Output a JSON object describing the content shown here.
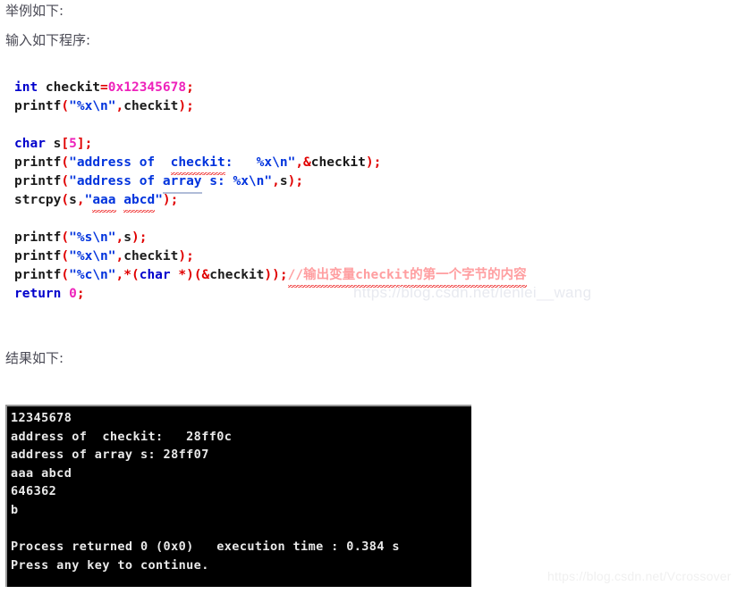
{
  "prose": [
    "举例如下:",
    "输入如下程序:",
    "结果如下:"
  ],
  "code": {
    "lines": [
      {
        "id": "line-declare-checkit",
        "tokens": [
          {
            "cls": "t-kw",
            "text": "int"
          },
          {
            "cls": "t-plain",
            "text": " checkit"
          },
          {
            "cls": "t-punc",
            "text": "="
          },
          {
            "cls": "t-num",
            "text": "0x12345678"
          },
          {
            "cls": "t-punc",
            "text": ";"
          }
        ]
      },
      {
        "id": "line-printf-hex-checkit-1",
        "tokens": [
          {
            "cls": "t-plain",
            "text": "printf"
          },
          {
            "cls": "t-punc",
            "text": "("
          },
          {
            "cls": "t-str",
            "text": "\"%x\\n\""
          },
          {
            "cls": "t-punc",
            "text": ","
          },
          {
            "cls": "t-plain",
            "text": "checkit"
          },
          {
            "cls": "t-punc",
            "text": ");"
          }
        ]
      },
      {
        "id": "line-blank-1",
        "tokens": []
      },
      {
        "id": "line-declare-array-s",
        "tokens": [
          {
            "cls": "t-kw",
            "text": "char"
          },
          {
            "cls": "t-plain",
            "text": " s"
          },
          {
            "cls": "t-punc",
            "text": "["
          },
          {
            "cls": "t-num",
            "text": "5"
          },
          {
            "cls": "t-punc",
            "text": "];"
          }
        ]
      },
      {
        "id": "line-printf-address-checkit",
        "tokens": [
          {
            "cls": "t-plain",
            "text": "printf"
          },
          {
            "cls": "t-punc",
            "text": "("
          },
          {
            "cls": "t-str",
            "text": "\"address of  "
          },
          {
            "cls": "t-str squig",
            "text": "checkit"
          },
          {
            "cls": "t-str",
            "text": ":   %x\\n\""
          },
          {
            "cls": "t-punc",
            "text": ",&"
          },
          {
            "cls": "t-plain",
            "text": "checkit"
          },
          {
            "cls": "t-punc",
            "text": ");"
          }
        ]
      },
      {
        "id": "line-printf-address-array",
        "tokens": [
          {
            "cls": "t-plain",
            "text": "printf"
          },
          {
            "cls": "t-punc",
            "text": "("
          },
          {
            "cls": "t-str",
            "text": "\"address of "
          },
          {
            "cls": "t-str squig-solid",
            "text": "array"
          },
          {
            "cls": "t-str",
            "text": " s: %x\\n\""
          },
          {
            "cls": "t-punc",
            "text": ","
          },
          {
            "cls": "t-plain",
            "text": "s"
          },
          {
            "cls": "t-punc",
            "text": ");"
          }
        ]
      },
      {
        "id": "line-strcpy",
        "tokens": [
          {
            "cls": "t-plain",
            "text": "strcpy"
          },
          {
            "cls": "t-punc",
            "text": "("
          },
          {
            "cls": "t-plain",
            "text": "s"
          },
          {
            "cls": "t-punc",
            "text": ","
          },
          {
            "cls": "t-str",
            "text": "\""
          },
          {
            "cls": "t-str squig",
            "text": "aaa"
          },
          {
            "cls": "t-str",
            "text": " "
          },
          {
            "cls": "t-str squig",
            "text": "abcd"
          },
          {
            "cls": "t-str",
            "text": "\""
          },
          {
            "cls": "t-punc",
            "text": ");"
          }
        ]
      },
      {
        "id": "line-blank-2",
        "tokens": []
      },
      {
        "id": "line-printf-string-s",
        "tokens": [
          {
            "cls": "t-plain",
            "text": "printf"
          },
          {
            "cls": "t-punc",
            "text": "("
          },
          {
            "cls": "t-str",
            "text": "\"%s\\n\""
          },
          {
            "cls": "t-punc",
            "text": ","
          },
          {
            "cls": "t-plain",
            "text": "s"
          },
          {
            "cls": "t-punc",
            "text": ");"
          }
        ]
      },
      {
        "id": "line-printf-hex-checkit-2",
        "tokens": [
          {
            "cls": "t-plain",
            "text": "printf"
          },
          {
            "cls": "t-punc",
            "text": "("
          },
          {
            "cls": "t-str",
            "text": "\"%x\\n\""
          },
          {
            "cls": "t-punc",
            "text": ","
          },
          {
            "cls": "t-plain",
            "text": "checkit"
          },
          {
            "cls": "t-punc",
            "text": ");"
          }
        ]
      },
      {
        "id": "line-printf-char-cast",
        "tokens": [
          {
            "cls": "t-plain",
            "text": "printf"
          },
          {
            "cls": "t-punc",
            "text": "("
          },
          {
            "cls": "t-str",
            "text": "\"%c\\n\""
          },
          {
            "cls": "t-punc",
            "text": ",*("
          },
          {
            "cls": "t-kw",
            "text": "char"
          },
          {
            "cls": "t-punc",
            "text": " *)(&"
          },
          {
            "cls": "t-plain",
            "text": "checkit"
          },
          {
            "cls": "t-punc",
            "text": "));"
          },
          {
            "cls": "t-cmt squig",
            "text": "//输出变量checkit的第一个字节的内容"
          }
        ]
      },
      {
        "id": "line-return",
        "tokens": [
          {
            "cls": "t-kw",
            "text": "return"
          },
          {
            "cls": "t-plain",
            "text": " "
          },
          {
            "cls": "t-num",
            "text": "0"
          },
          {
            "cls": "t-punc",
            "text": ";"
          }
        ]
      }
    ]
  },
  "console": {
    "lines": [
      "12345678",
      "address of  checkit:   28ff0c",
      "address of array s: 28ff07",
      "aaa abcd",
      "646362",
      "b",
      "",
      "Process returned 0 (0x0)   execution time : 0.384 s",
      "Press any key to continue."
    ]
  },
  "watermarks": {
    "inline": "https://blog.csdn.net/lenlei__wang",
    "corner": "https://blog.csdn.net/Vcrossover"
  },
  "colors": {
    "keyword": "#0000cc",
    "punctuation": "#e00000",
    "number": "#ee22bb",
    "string": "#0033dd",
    "comment": "#ff9ea0",
    "console_bg": "#000000",
    "console_fg": "#e9e9e9",
    "prose": "#4a4a55"
  }
}
